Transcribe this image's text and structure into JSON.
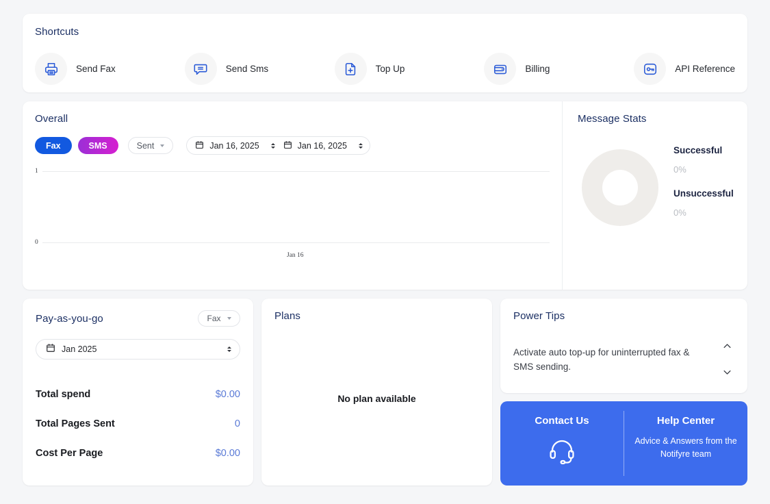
{
  "shortcuts": {
    "title": "Shortcuts",
    "items": [
      {
        "label": "Send Fax",
        "icon": "fax-printer-icon"
      },
      {
        "label": "Send Sms",
        "icon": "chat-bubble-icon"
      },
      {
        "label": "Top Up",
        "icon": "document-plus-icon"
      },
      {
        "label": "Billing",
        "icon": "wallet-icon"
      },
      {
        "label": "API Reference",
        "icon": "key-icon"
      }
    ]
  },
  "overall": {
    "title": "Overall",
    "fax_label": "Fax",
    "sms_label": "SMS",
    "status_label": "Sent",
    "date_from": "Jan 16, 2025",
    "date_to": "Jan 16, 2025"
  },
  "chart_data": {
    "type": "line",
    "title": "Overall",
    "x": [
      "Jan 16"
    ],
    "series": [
      {
        "name": "Fax",
        "values": [
          0
        ]
      },
      {
        "name": "SMS",
        "values": [
          0
        ]
      }
    ],
    "xlabel": "",
    "ylabel": "",
    "ylim": [
      0,
      1
    ],
    "yticks": [
      "0",
      "1"
    ],
    "xticks": [
      "Jan 16"
    ],
    "grid": true,
    "legend": "none"
  },
  "message_stats": {
    "title": "Message Stats",
    "donut_color": "#efedea",
    "items": [
      {
        "name": "Successful",
        "value": "0%"
      },
      {
        "name": "Unsuccessful",
        "value": "0%"
      }
    ]
  },
  "payg": {
    "title": "Pay-as-you-go",
    "type_label": "Fax",
    "month_value": "Jan 2025",
    "rows": [
      {
        "label": "Total spend",
        "value": "$0.00"
      },
      {
        "label": "Total Pages Sent",
        "value": "0"
      },
      {
        "label": "Cost Per Page",
        "value": "$0.00"
      }
    ]
  },
  "plans": {
    "title": "Plans",
    "empty_text": "No plan available"
  },
  "power_tips": {
    "title": "Power Tips",
    "tip": "Activate auto top-up for uninterrupted fax & SMS sending."
  },
  "support": {
    "contact_title": "Contact Us",
    "help_title": "Help Center",
    "help_sub": "Advice & Answers from the Notifyre team",
    "accent": "#3d6ced"
  }
}
